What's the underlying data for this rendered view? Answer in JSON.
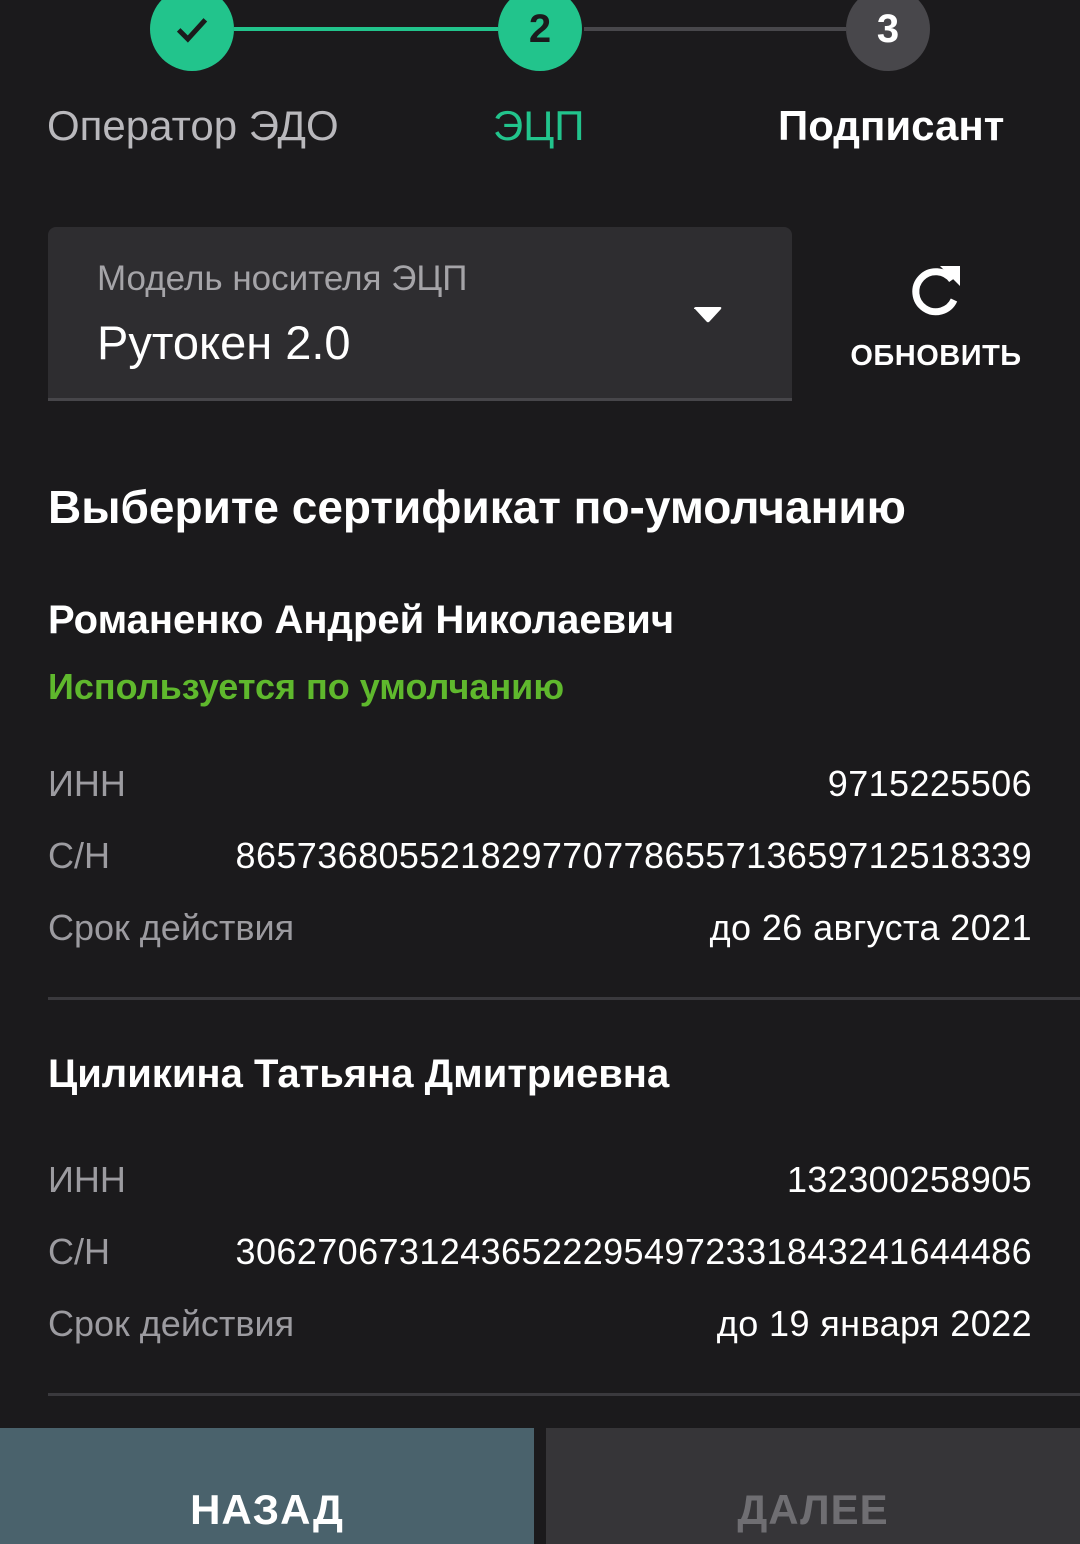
{
  "stepper": {
    "steps": [
      {
        "label": "Оператор ЭДО",
        "state": "done",
        "icon": "check-icon"
      },
      {
        "label": "ЭЦП",
        "state": "active",
        "number": "2"
      },
      {
        "label": "Подписант",
        "state": "pending",
        "number": "3"
      }
    ]
  },
  "carrier": {
    "label": "Модель носителя ЭЦП",
    "value": "Рутокен 2.0",
    "dropdown_icon": "caret-down-icon"
  },
  "refresh": {
    "label": "ОБНОВИТЬ",
    "icon": "refresh-icon"
  },
  "section_title": "Выберите сертификат по-умолчанию",
  "certificates": [
    {
      "name": "Романенко Андрей Николаевич",
      "default_label": "Используется по умолчанию",
      "inn_label": "ИНН",
      "inn": "9715225506",
      "sn_label": "С/Н",
      "sn": "865736805521829770778655713659712518339",
      "validity_label": "Срок действия",
      "validity": "до 26 августа 2021"
    },
    {
      "name": "Циликина Татьяна Дмитриевна",
      "inn_label": "ИНН",
      "inn": "132300258905",
      "sn_label": "С/Н",
      "sn": "306270673124365222954972331843241644486",
      "validity_label": "Срок действия",
      "validity": "до 19 января 2022"
    }
  ],
  "buttons": {
    "back": "НАЗАД",
    "next": "ДАЛЕЕ"
  },
  "colors": {
    "accent": "#22c48c",
    "default_green": "#5fb82d",
    "background": "#1b1a1c"
  }
}
